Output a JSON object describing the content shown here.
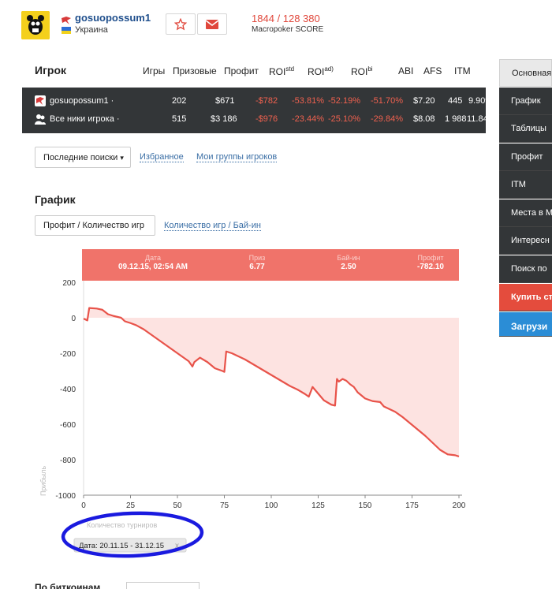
{
  "header": {
    "username": "gosuopossum1",
    "country": "Украина",
    "score_value": "1844 / 128 380",
    "score_label": "Macropoker SCORE",
    "icons": [
      "poker-site-icon",
      "star-icon",
      "mail-icon"
    ]
  },
  "table": {
    "player_col": "Игрок",
    "columns": [
      {
        "label": "Игры",
        "sup": ""
      },
      {
        "label": "Призовые",
        "sup": ""
      },
      {
        "label": "Профит",
        "sup": ""
      },
      {
        "label": "ROI",
        "sup": "std"
      },
      {
        "label": "ROI",
        "sup": "ad)"
      },
      {
        "label": "ROI",
        "sup": "bi"
      },
      {
        "label": "ABI",
        "sup": ""
      },
      {
        "label": "AFS",
        "sup": ""
      },
      {
        "label": "ITM",
        "sup": ""
      }
    ],
    "rows": [
      {
        "name": "gosuopossum1 ·",
        "games": "202",
        "prize": "$671",
        "profit": "-$782",
        "roi_std": "-53.81%",
        "roi_adj": "-52.19%",
        "roi_bi": "-51.70%",
        "abi": "$7.20",
        "afs": "445",
        "itm": "9.90%"
      },
      {
        "name": "Все ники игрока ·",
        "games": "515",
        "prize": "$3 186",
        "profit": "-$976",
        "roi_std": "-23.44%",
        "roi_adj": "-25.10%",
        "roi_bi": "-29.84%",
        "abi": "$8.08",
        "afs": "1 988",
        "itm": "11.84%"
      }
    ]
  },
  "filters": {
    "recent_searches": "Последние поиски",
    "favorites": "Избранное",
    "my_groups": "Мои группы игроков"
  },
  "graph": {
    "title": "График",
    "tab_active": "Профит / Количество игр",
    "tab_other": "Количество игр / Бай-ин",
    "tooltip": [
      {
        "label": "Дата",
        "value": "09.12.15, 02:54 AM"
      },
      {
        "label": "Приз",
        "value": "6.77"
      },
      {
        "label": "Бай-ин",
        "value": "2.50"
      },
      {
        "label": "Профит",
        "value": "-782.10"
      }
    ],
    "xlabel": "Количество турниров",
    "date_chip": "Дата: 20.11.15 - 31.12.15",
    "chip_close": "x"
  },
  "chart_data": {
    "type": "area",
    "xlabel": "Количество турниров",
    "ylabel": "Прибыль",
    "xlim": [
      0,
      200
    ],
    "ylim": [
      -1000,
      200
    ],
    "xticks": [
      "0",
      "25",
      "50",
      "75",
      "100",
      "125",
      "150",
      "175",
      "200"
    ],
    "yticks": [
      "200",
      "0",
      "-200",
      "-400",
      "-600",
      "-800",
      "-1000"
    ],
    "line_color": "#e8534a",
    "fill_color": "#fde3e1",
    "series": [
      {
        "x": [
          0,
          2,
          3,
          7,
          10,
          13,
          16,
          20,
          22,
          25,
          28,
          32,
          36,
          40,
          44,
          48,
          52,
          56,
          58,
          59,
          62,
          66,
          70,
          74,
          75,
          76,
          79,
          82,
          86,
          90,
          94,
          98,
          102,
          106,
          110,
          114,
          118,
          120,
          122,
          124,
          126,
          128,
          132,
          134,
          135,
          136,
          138,
          140,
          142,
          144,
          146,
          150,
          154,
          158,
          160,
          162,
          166,
          170,
          174,
          178,
          182,
          186,
          190,
          194,
          198,
          200
        ],
        "y": [
          -5,
          -15,
          55,
          52,
          45,
          20,
          10,
          0,
          -20,
          -30,
          -42,
          -65,
          -95,
          -125,
          -155,
          -185,
          -215,
          -245,
          -275,
          -250,
          -225,
          -250,
          -285,
          -300,
          -305,
          -190,
          -200,
          -215,
          -235,
          -260,
          -285,
          -310,
          -335,
          -360,
          -385,
          -405,
          -430,
          -445,
          -390,
          -415,
          -440,
          -465,
          -490,
          -495,
          -345,
          -360,
          -345,
          -355,
          -375,
          -390,
          -420,
          -455,
          -470,
          -475,
          -500,
          -510,
          -530,
          -560,
          -595,
          -630,
          -665,
          -705,
          -745,
          -770,
          -775,
          -782
        ]
      }
    ]
  },
  "right_menu": {
    "items": [
      "Основная",
      "График",
      "Таблицы",
      "Профит",
      "ITM",
      "Места в M",
      "Интересн",
      "Поиск по"
    ],
    "buy_button": "Купить ст",
    "upload_button": "Загрузи"
  },
  "footer": {
    "partial_title": "По биткоинам"
  }
}
